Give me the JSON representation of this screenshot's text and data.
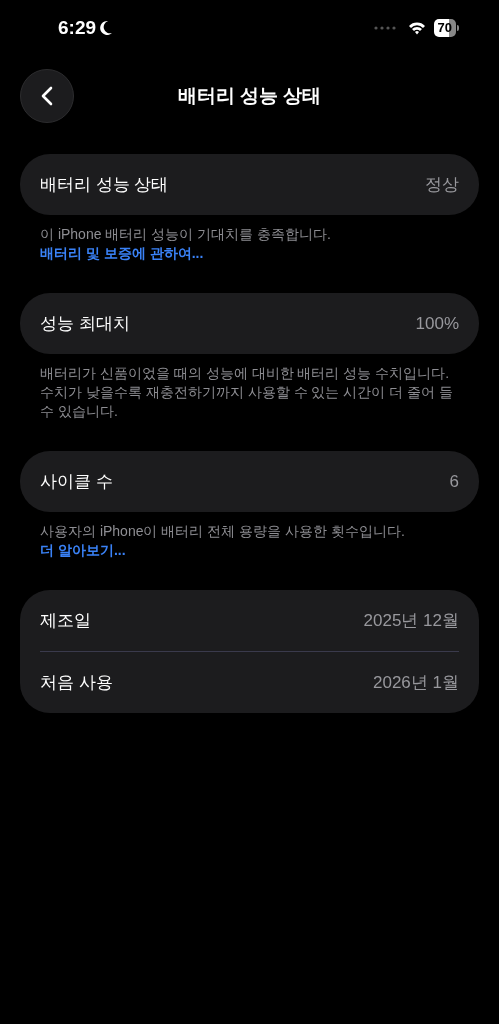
{
  "status_bar": {
    "time": "6:29",
    "battery": "70"
  },
  "header": {
    "title": "배터리 성능 상태"
  },
  "sections": [
    {
      "rows": [
        {
          "label": "배터리 성능 상태",
          "value": "정상"
        }
      ],
      "footnote": {
        "text": "이 iPhone 배터리 성능이 기대치를 충족합니다. ",
        "link": "배터리 및 보증에 관하여..."
      }
    },
    {
      "rows": [
        {
          "label": "성능 최대치",
          "value": "100%"
        }
      ],
      "footnote": {
        "text": "배터리가 신품이었을 때의 성능에 대비한 배터리 성능 수치입니다. 수치가 낮을수록 재충전하기까지 사용할 수 있는 시간이 더 줄어 들 수 있습니다."
      }
    },
    {
      "rows": [
        {
          "label": "사이클 수",
          "value": "6"
        }
      ],
      "footnote": {
        "text": "사용자의 iPhone이 배터리 전체 용량을 사용한 횟수입니다. ",
        "link": "더 알아보기..."
      }
    },
    {
      "rows": [
        {
          "label": "제조일",
          "value": "2025년 12월"
        },
        {
          "label": "처음 사용",
          "value": "2026년 1월"
        }
      ]
    }
  ]
}
